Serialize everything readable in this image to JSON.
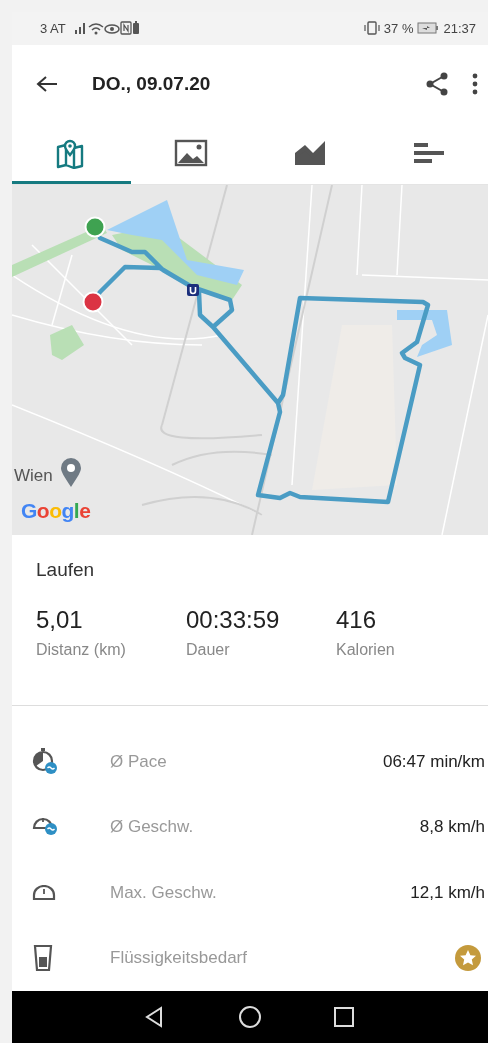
{
  "status_bar": {
    "carrier": "3 AT",
    "battery": "37 %",
    "time": "21:37"
  },
  "app_bar": {
    "title": "DO., 09.07.20"
  },
  "tabs": [
    {
      "selected": true
    },
    {
      "selected": false
    },
    {
      "selected": false
    },
    {
      "selected": false
    }
  ],
  "map": {
    "place_label": "Wien",
    "attribution": "Google"
  },
  "activity": {
    "type": "Laufen"
  },
  "stats": [
    {
      "value": "5,01",
      "label": "Distanz (km)"
    },
    {
      "value": "00:33:59",
      "label": "Dauer"
    },
    {
      "value": "416",
      "label": "Kalorien"
    }
  ],
  "details": [
    {
      "label": "Ø Pace",
      "kind": "value",
      "value": "06:47 min/km"
    },
    {
      "label": "Ø Geschw.",
      "kind": "value",
      "value": "8,8 km/h"
    },
    {
      "label": "Max. Geschw.",
      "kind": "value",
      "value": "12,1 km/h"
    },
    {
      "label": "Flüssigkeitsbedarf",
      "kind": "premium"
    }
  ]
}
